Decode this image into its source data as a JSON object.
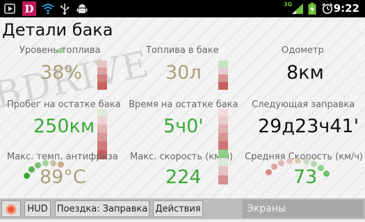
{
  "status_bar": {
    "time": "9:22",
    "network_label": "3G",
    "notification_icons": [
      "video-icon",
      "d-app-icon",
      "wifi-icon",
      "usb-icon",
      "android-icon"
    ]
  },
  "header": {
    "title": "Детали бака"
  },
  "watermark": "BDRIVE",
  "tiles": [
    {
      "label": "Уровень топлива",
      "value": "38%",
      "color": "#a8a27a"
    },
    {
      "label": "Топлива в баке",
      "value": "30л",
      "color": "#a8a27a"
    },
    {
      "label": "Одометр",
      "value": "8км",
      "color": "#111111"
    },
    {
      "label": "Пробег на остатке бака",
      "value": "250км",
      "color": "#3aa935"
    },
    {
      "label": "Время на остатке бака",
      "value": "5ч0'",
      "color": "#3aa935"
    },
    {
      "label": "Следующая заправка",
      "value": "29д23ч41'",
      "color": "#111111"
    },
    {
      "label": "Макс. темп. антифриза",
      "value": "89°C",
      "color": "#a8a27a"
    },
    {
      "label": "Макс. скорость (км/ч)",
      "value": "224",
      "color": "#3aa935"
    },
    {
      "label": "Средняя Скорость (км/ч)",
      "value": "73",
      "color": "#3aa935"
    }
  ],
  "bottom_bar": {
    "record_icon": "record-icon",
    "hud_label": "HUD",
    "trip_label": "Поездка: Заправка",
    "actions_label": "Действия",
    "screens_label": "Экраны"
  }
}
